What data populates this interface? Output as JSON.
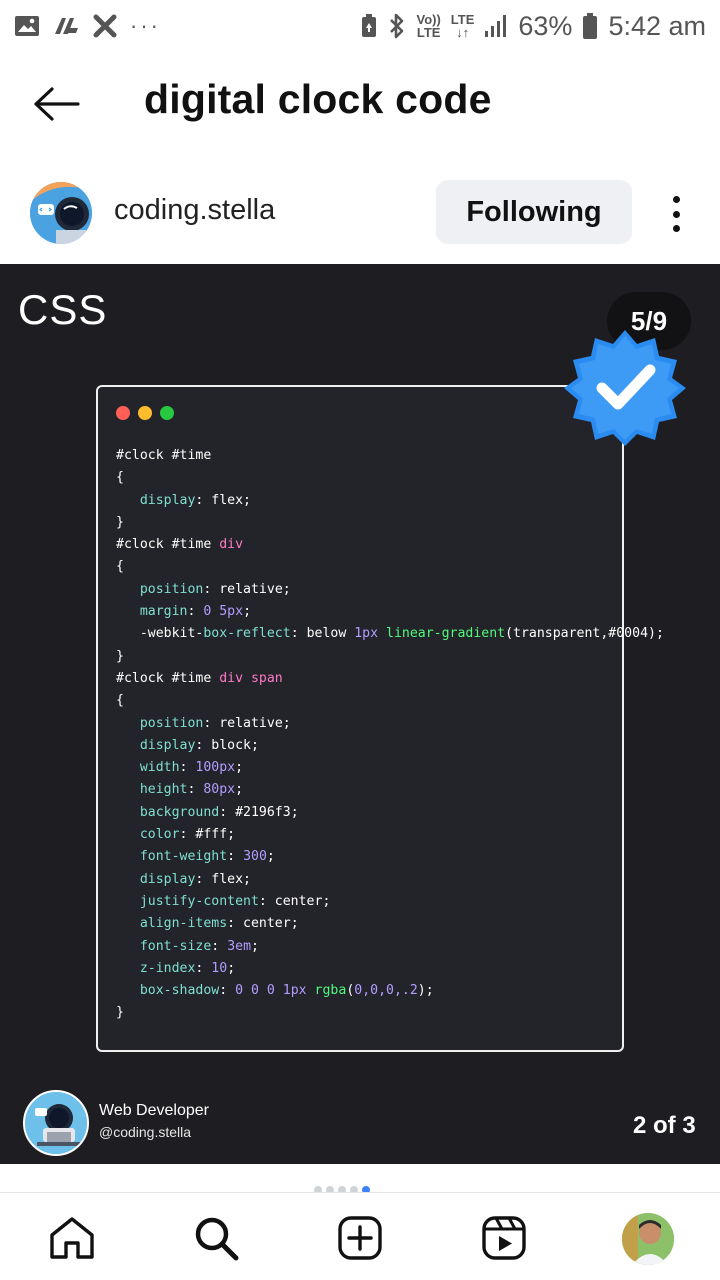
{
  "status_bar": {
    "battery": "63%",
    "time": "5:42 am",
    "volte_label_top": "Vo))",
    "volte_label_bottom": "LTE",
    "network_label": "LTE"
  },
  "header": {
    "title": "digital clock code"
  },
  "profile": {
    "username": "coding.stella",
    "follow_label": "Following"
  },
  "post": {
    "heading": "CSS",
    "page_counter": "5/9",
    "code_lines": [
      [
        {
          "t": "#clock #time",
          "c": "txt"
        }
      ],
      [
        {
          "t": "{",
          "c": "txt"
        }
      ],
      [
        {
          "t": "   ",
          "c": "txt"
        },
        {
          "t": "display",
          "c": "prop"
        },
        {
          "t": ": flex;",
          "c": "txt"
        }
      ],
      [
        {
          "t": "}",
          "c": "txt"
        }
      ],
      [
        {
          "t": "#clock #time ",
          "c": "txt"
        },
        {
          "t": "div",
          "c": "tag"
        }
      ],
      [
        {
          "t": "{",
          "c": "txt"
        }
      ],
      [
        {
          "t": "   ",
          "c": "txt"
        },
        {
          "t": "position",
          "c": "prop"
        },
        {
          "t": ": relative;",
          "c": "txt"
        }
      ],
      [
        {
          "t": "   ",
          "c": "txt"
        },
        {
          "t": "margin",
          "c": "prop"
        },
        {
          "t": ": ",
          "c": "txt"
        },
        {
          "t": "0 5px",
          "c": "num"
        },
        {
          "t": ";",
          "c": "txt"
        }
      ],
      [
        {
          "t": "   -webkit-",
          "c": "txt"
        },
        {
          "t": "box-reflect",
          "c": "prop"
        },
        {
          "t": ": below ",
          "c": "txt"
        },
        {
          "t": "1px",
          "c": "num"
        },
        {
          "t": " ",
          "c": "txt"
        },
        {
          "t": "linear-gradient",
          "c": "fn"
        },
        {
          "t": "(transparent,#0004);",
          "c": "txt"
        }
      ],
      [
        {
          "t": "}",
          "c": "txt"
        }
      ],
      [
        {
          "t": "#clock #time ",
          "c": "txt"
        },
        {
          "t": "div span",
          "c": "tag"
        }
      ],
      [
        {
          "t": "{",
          "c": "txt"
        }
      ],
      [
        {
          "t": "   ",
          "c": "txt"
        },
        {
          "t": "position",
          "c": "prop"
        },
        {
          "t": ": relative;",
          "c": "txt"
        }
      ],
      [
        {
          "t": "   ",
          "c": "txt"
        },
        {
          "t": "display",
          "c": "prop"
        },
        {
          "t": ": block;",
          "c": "txt"
        }
      ],
      [
        {
          "t": "   ",
          "c": "txt"
        },
        {
          "t": "width",
          "c": "prop"
        },
        {
          "t": ": ",
          "c": "txt"
        },
        {
          "t": "100px",
          "c": "num"
        },
        {
          "t": ";",
          "c": "txt"
        }
      ],
      [
        {
          "t": "   ",
          "c": "txt"
        },
        {
          "t": "height",
          "c": "prop"
        },
        {
          "t": ": ",
          "c": "txt"
        },
        {
          "t": "80px",
          "c": "num"
        },
        {
          "t": ";",
          "c": "txt"
        }
      ],
      [
        {
          "t": "   ",
          "c": "txt"
        },
        {
          "t": "background",
          "c": "prop"
        },
        {
          "t": ": #2196f3;",
          "c": "txt"
        }
      ],
      [
        {
          "t": "   ",
          "c": "txt"
        },
        {
          "t": "color",
          "c": "prop"
        },
        {
          "t": ": #fff;",
          "c": "txt"
        }
      ],
      [
        {
          "t": "   ",
          "c": "txt"
        },
        {
          "t": "font-weight",
          "c": "prop"
        },
        {
          "t": ": ",
          "c": "txt"
        },
        {
          "t": "300",
          "c": "num"
        },
        {
          "t": ";",
          "c": "txt"
        }
      ],
      [
        {
          "t": "   ",
          "c": "txt"
        },
        {
          "t": "display",
          "c": "prop"
        },
        {
          "t": ": flex;",
          "c": "txt"
        }
      ],
      [
        {
          "t": "   ",
          "c": "txt"
        },
        {
          "t": "justify-content",
          "c": "prop"
        },
        {
          "t": ": center;",
          "c": "txt"
        }
      ],
      [
        {
          "t": "   ",
          "c": "txt"
        },
        {
          "t": "align-items",
          "c": "prop"
        },
        {
          "t": ": center;",
          "c": "txt"
        }
      ],
      [
        {
          "t": "   ",
          "c": "txt"
        },
        {
          "t": "font-size",
          "c": "prop"
        },
        {
          "t": ": ",
          "c": "txt"
        },
        {
          "t": "3em",
          "c": "num"
        },
        {
          "t": ";",
          "c": "txt"
        }
      ],
      [
        {
          "t": "   ",
          "c": "txt"
        },
        {
          "t": "z-index",
          "c": "prop"
        },
        {
          "t": ": ",
          "c": "txt"
        },
        {
          "t": "10",
          "c": "num"
        },
        {
          "t": ";",
          "c": "txt"
        }
      ],
      [
        {
          "t": "   ",
          "c": "txt"
        },
        {
          "t": "box-shadow",
          "c": "prop"
        },
        {
          "t": ": ",
          "c": "txt"
        },
        {
          "t": "0 0 0 1px",
          "c": "num"
        },
        {
          "t": " ",
          "c": "txt"
        },
        {
          "t": "rgba",
          "c": "fn"
        },
        {
          "t": "(",
          "c": "txt"
        },
        {
          "t": "0,0,0,.2",
          "c": "num"
        },
        {
          "t": ");",
          "c": "txt"
        }
      ],
      [
        {
          "t": "}",
          "c": "txt"
        }
      ]
    ],
    "author_title": "Web Developer",
    "author_handle": "@coding.stella",
    "slide_count": "2 of 3"
  },
  "colors": {
    "post_bg": "#1e1e22",
    "code_prop": "#7fe0d0",
    "code_num": "#b39dff",
    "code_tag": "#ff79c6",
    "code_fn": "#50fa7b",
    "badge_blue": "#2a8cf0",
    "indicator_active": "#3b82f6"
  },
  "icons": {
    "status_left": [
      "gallery-icon",
      "app-icon",
      "tools-icon",
      "more-notifications-icon"
    ],
    "status_right": [
      "battery-saver-icon",
      "bluetooth-icon",
      "volte-icon",
      "signal-icon",
      "battery-icon"
    ],
    "nav": [
      "home-icon",
      "search-icon",
      "create-post-icon",
      "reels-icon",
      "profile-avatar"
    ]
  },
  "carousel": {
    "count": 5,
    "active_index": 4
  }
}
